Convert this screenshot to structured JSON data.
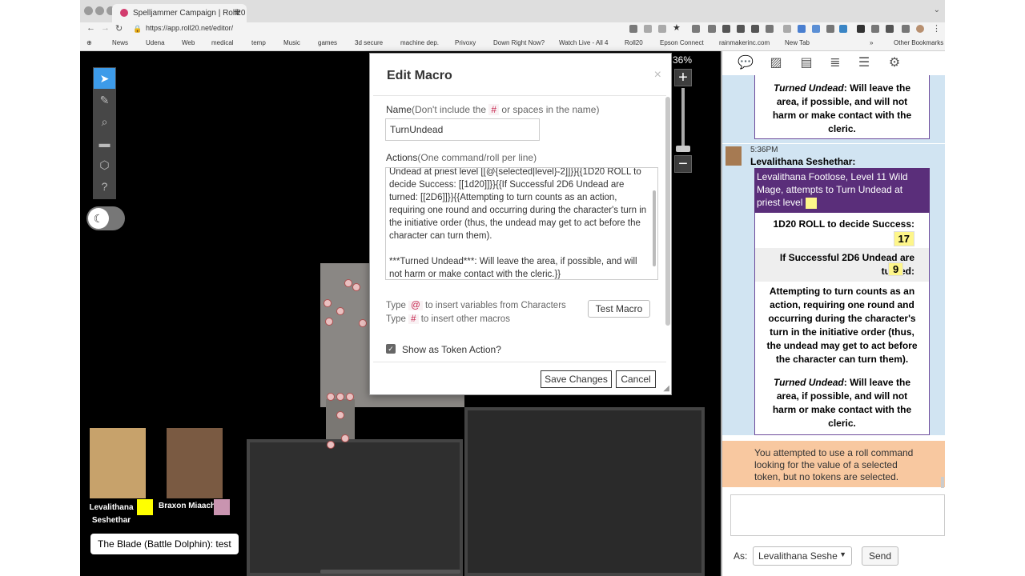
{
  "browser": {
    "tab_title": "Spelljammer Campaign | Roll20",
    "tab_close": "×",
    "new_tab": "+",
    "url": "https://app.roll20.net/editor/",
    "bookmarks": [
      "News",
      "Udena",
      "Web",
      "medical",
      "temp",
      "Music",
      "games",
      "3d secure",
      "machine dep.",
      "Privoxy",
      "Down Right Now?",
      "Watch Live - All 4",
      "Roll20",
      "Epson Connect",
      "rainmakerinc.com",
      "New Tab"
    ],
    "bookmarks_more": "»",
    "other_bookmarks": "Other Bookmarks"
  },
  "zoom": {
    "percent": "36%",
    "plus": "+",
    "minus": "−"
  },
  "dialog": {
    "title": "Edit Macro",
    "close": "×",
    "name_label": "Name",
    "name_hint_pre": "(Don't include the ",
    "name_hint_code": "#",
    "name_hint_post": " or spaces in the name)",
    "name_value": "TurnUndead",
    "actions_label": "Actions",
    "actions_hint": "(One command/roll per line)",
    "actions_text": "Undead at priest level [[@{selected|level}-2]]}}{{1D20 ROLL to decide Success: [[1d20]]}}{{If Successful 2D6 Undead are turned: [[2D6]]}}{{Attempting to turn counts as an action, requiring one round and occurring during the character's turn in the initiative order (thus, the undead may get to act before the character can turn them).\n\n***Turned Undead***: Will leave the area, if possible, and will not harm or make contact with the cleric.}}",
    "hint1_pre": "Type ",
    "hint1_code": "@",
    "hint1_post": " to insert variables from Characters",
    "hint2_pre": "Type ",
    "hint2_code": "#",
    "hint2_post": " to insert other macros",
    "test_button": "Test Macro",
    "token_action_label": "Show as Token Action?",
    "token_action_checked": true,
    "save_button": "Save Changes",
    "cancel_button": "Cancel"
  },
  "players": [
    {
      "name": "Levalithana Seshethar",
      "color": "#ffff00"
    },
    {
      "name": "Braxon Miaach",
      "color": "#c994b0"
    }
  ],
  "status_message": "The Blade (Battle Dolphin): test",
  "chat": {
    "prev_turned_label": "Turned Undead",
    "prev_turned_text": ": Will leave the area, if possible, and will not harm or make contact with the cleric.",
    "timestamp": "5:36PM",
    "sender": "Levalithana Seshethar:",
    "roll_header": "Levalithana Footlose, Level 11 Wild Mage, attempts to Turn Undead at priest level",
    "row1_label": "1D20 ROLL to decide Success:",
    "row1_value": "17",
    "row2_label": "If Successful 2D6 Undead are turned:",
    "row2_value": "9",
    "description": "Attempting to turn counts as an action, requiring one round and occurring during the character's turn in the initiative order (thus, the undead may get to act before the character can turn them).",
    "turned_label": "Turned Undead",
    "turned_text": ": Will leave the area, if possible, and will not harm or make contact with the cleric.",
    "warning": "You attempted to use a roll command looking for the value of a selected token, but no tokens are selected.",
    "as_label": "As:",
    "as_value": "Levalithana Seshe",
    "send_button": "Send"
  },
  "colors": {
    "roll_header_bg": "#5a2e7a",
    "roll_value_bg": "#fef68a",
    "chat_msg_bg": "#d1e4f2",
    "warning_bg": "#f8c8a0",
    "active_tool": "#3d9be9"
  },
  "icons": {
    "tools": [
      "select-pointer-icon",
      "brush-icon",
      "zoom-icon",
      "ruler-icon",
      "dice-icon",
      "help-icon"
    ],
    "sidebar_tabs": [
      "chat-icon",
      "art-library-icon",
      "journal-icon",
      "compendium-icon",
      "jukebox-icon",
      "settings-icon"
    ],
    "night_mode": "moon-icon"
  }
}
